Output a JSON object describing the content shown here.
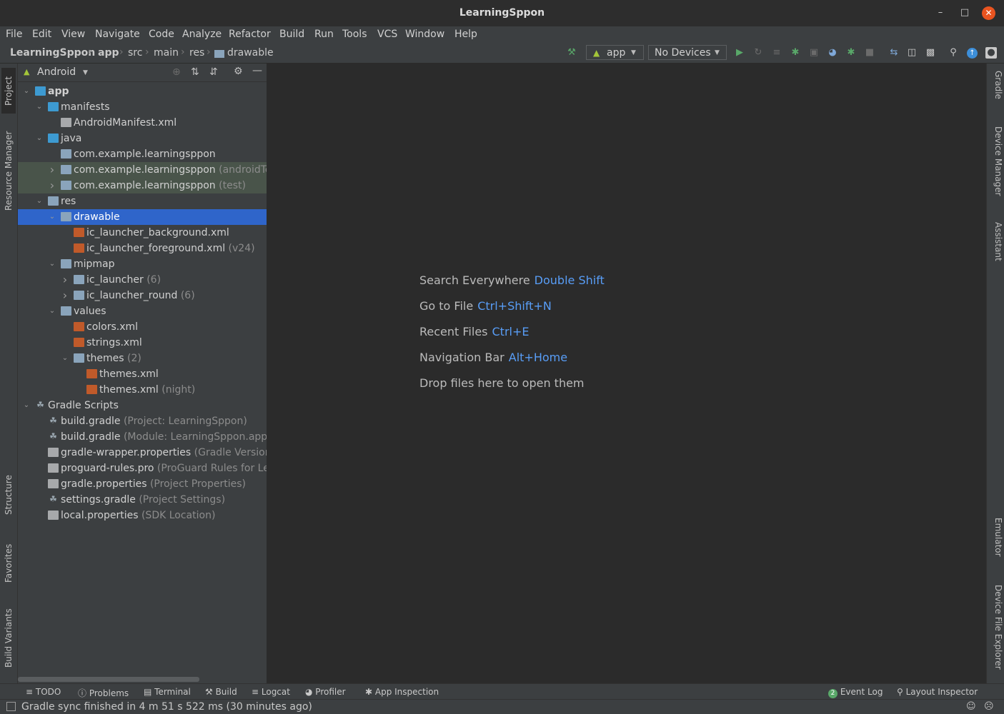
{
  "window": {
    "title": "LearningSppon"
  },
  "menu": [
    "File",
    "Edit",
    "View",
    "Navigate",
    "Code",
    "Analyze",
    "Refactor",
    "Build",
    "Run",
    "Tools",
    "VCS",
    "Window",
    "Help"
  ],
  "breadcrumb": [
    "LearningSppon",
    "app",
    "src",
    "main",
    "res",
    "drawable"
  ],
  "toolbar": {
    "run_config": "app",
    "device": "No Devices"
  },
  "left_tabs": [
    "Project",
    "Resource Manager",
    "Structure",
    "Favorites",
    "Build Variants"
  ],
  "right_tabs": [
    "Gradle",
    "Device Manager",
    "Assistant",
    "Emulator",
    "Device File Explorer"
  ],
  "project_panel": {
    "view": "Android"
  },
  "tree": [
    {
      "label": "app",
      "hint": ""
    },
    {
      "label": "manifests",
      "hint": ""
    },
    {
      "label": "AndroidManifest.xml",
      "hint": ""
    },
    {
      "label": "java",
      "hint": ""
    },
    {
      "label": "com.example.learningsppon",
      "hint": ""
    },
    {
      "label": "com.example.learningsppon",
      "hint": "(androidTest)"
    },
    {
      "label": "com.example.learningsppon",
      "hint": "(test)"
    },
    {
      "label": "res",
      "hint": ""
    },
    {
      "label": "drawable",
      "hint": ""
    },
    {
      "label": "ic_launcher_background.xml",
      "hint": ""
    },
    {
      "label": "ic_launcher_foreground.xml",
      "hint": "(v24)"
    },
    {
      "label": "mipmap",
      "hint": ""
    },
    {
      "label": "ic_launcher",
      "hint": "(6)"
    },
    {
      "label": "ic_launcher_round",
      "hint": "(6)"
    },
    {
      "label": "values",
      "hint": ""
    },
    {
      "label": "colors.xml",
      "hint": ""
    },
    {
      "label": "strings.xml",
      "hint": ""
    },
    {
      "label": "themes",
      "hint": "(2)"
    },
    {
      "label": "themes.xml",
      "hint": ""
    },
    {
      "label": "themes.xml",
      "hint": "(night)"
    },
    {
      "label": "Gradle Scripts",
      "hint": ""
    },
    {
      "label": "build.gradle",
      "hint": "(Project: LearningSppon)"
    },
    {
      "label": "build.gradle",
      "hint": "(Module: LearningSppon.app)"
    },
    {
      "label": "gradle-wrapper.properties",
      "hint": "(Gradle Version)"
    },
    {
      "label": "proguard-rules.pro",
      "hint": "(ProGuard Rules for LearningSppon.app)"
    },
    {
      "label": "gradle.properties",
      "hint": "(Project Properties)"
    },
    {
      "label": "settings.gradle",
      "hint": "(Project Settings)"
    },
    {
      "label": "local.properties",
      "hint": "(SDK Location)"
    }
  ],
  "editor_hints": [
    {
      "text": "Search Everywhere",
      "key": "Double Shift"
    },
    {
      "text": "Go to File",
      "key": "Ctrl+Shift+N"
    },
    {
      "text": "Recent Files",
      "key": "Ctrl+E"
    },
    {
      "text": "Navigation Bar",
      "key": "Alt+Home"
    },
    {
      "text": "Drop files here to open them",
      "key": ""
    }
  ],
  "bottom_tools": [
    "TODO",
    "Problems",
    "Terminal",
    "Build",
    "Logcat",
    "Profiler",
    "App Inspection"
  ],
  "bottom_right": {
    "event_log": "Event Log",
    "event_count": "2",
    "layout_inspector": "Layout Inspector"
  },
  "status": "Gradle sync finished in 4 m 51 s 522 ms (30 minutes ago)",
  "colors": {
    "accent": "#589df6",
    "selection": "#2f65ca",
    "close": "#e95420",
    "run": "#59a869"
  }
}
